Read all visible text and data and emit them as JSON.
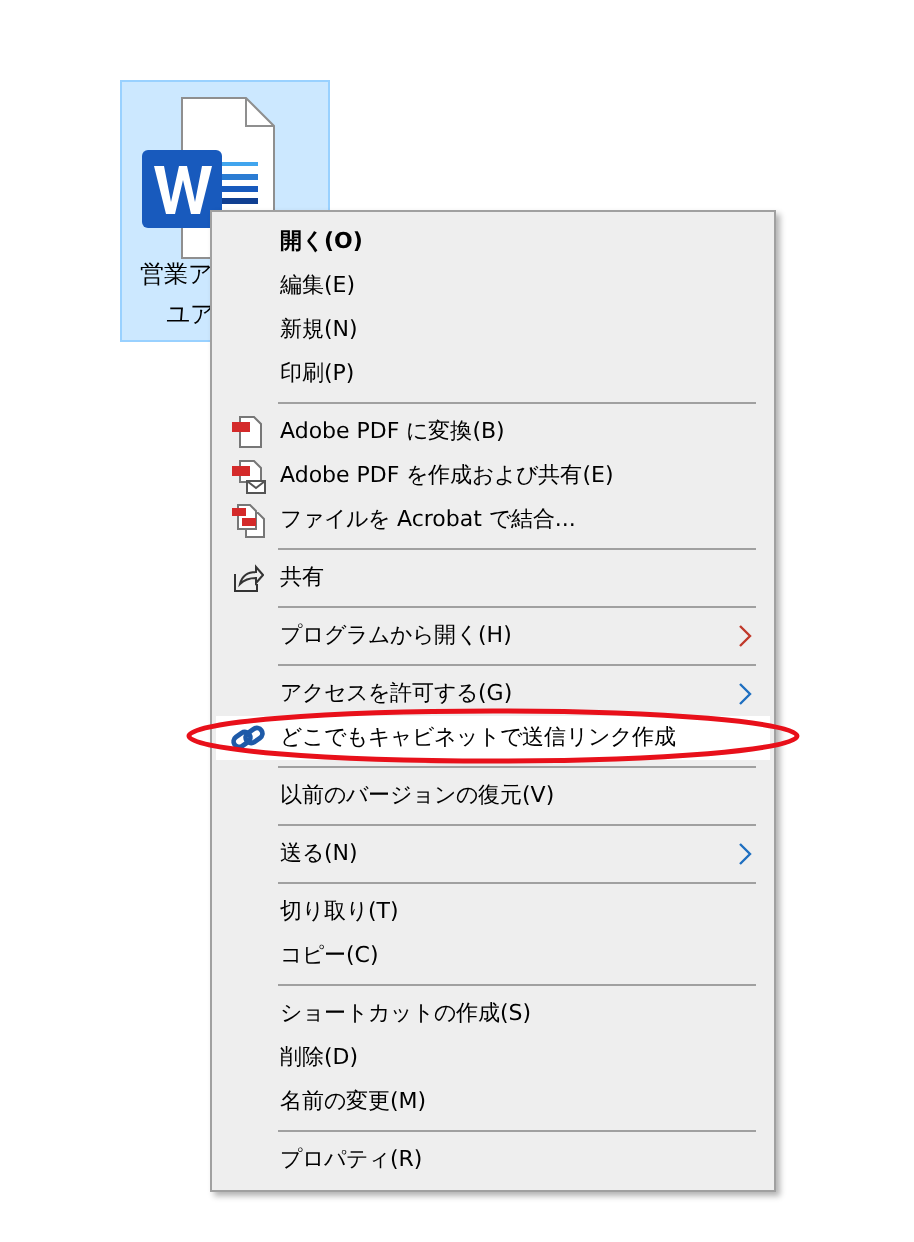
{
  "file": {
    "label_lines": [
      "営業ア",
      "ユア"
    ],
    "selected": true
  },
  "menu": {
    "items": [
      {
        "kind": "item",
        "label": "開く(O)",
        "bold": true,
        "submenu": false,
        "selected": false,
        "circled": false
      },
      {
        "kind": "item",
        "label": "編集(E)",
        "bold": false,
        "submenu": false,
        "selected": false,
        "circled": false
      },
      {
        "kind": "item",
        "label": "新規(N)",
        "bold": false,
        "submenu": false,
        "selected": false,
        "circled": false
      },
      {
        "kind": "item",
        "label": "印刷(P)",
        "bold": false,
        "submenu": false,
        "selected": false,
        "circled": false
      },
      {
        "kind": "separator"
      },
      {
        "kind": "item",
        "label": "Adobe PDF に変換(B)",
        "bold": false,
        "submenu": false,
        "selected": false,
        "circled": false
      },
      {
        "kind": "item",
        "label": "Adobe PDF を作成および共有(E)",
        "bold": false,
        "submenu": false,
        "selected": false,
        "circled": false
      },
      {
        "kind": "item",
        "label": "ファイルを Acrobat で結合...",
        "bold": false,
        "submenu": false,
        "selected": false,
        "circled": false
      },
      {
        "kind": "separator"
      },
      {
        "kind": "item",
        "label": "共有",
        "bold": false,
        "submenu": false,
        "selected": false,
        "circled": false
      },
      {
        "kind": "separator"
      },
      {
        "kind": "item",
        "label": "プログラムから開く(H)",
        "bold": false,
        "submenu": true,
        "selected": false,
        "circled": false
      },
      {
        "kind": "separator"
      },
      {
        "kind": "item",
        "label": "アクセスを許可する(G)",
        "bold": false,
        "submenu": true,
        "selected": false,
        "circled": false
      },
      {
        "kind": "item",
        "label": "どこでもキャビネットで送信リンク作成",
        "bold": false,
        "submenu": false,
        "selected": true,
        "circled": true
      },
      {
        "kind": "separator"
      },
      {
        "kind": "item",
        "label": "以前のバージョンの復元(V)",
        "bold": false,
        "submenu": false,
        "selected": false,
        "circled": false
      },
      {
        "kind": "separator"
      },
      {
        "kind": "item",
        "label": "送る(N)",
        "bold": false,
        "submenu": true,
        "selected": false,
        "circled": false
      },
      {
        "kind": "separator"
      },
      {
        "kind": "item",
        "label": "切り取り(T)",
        "bold": false,
        "submenu": false,
        "selected": false,
        "circled": false
      },
      {
        "kind": "item",
        "label": "コピー(C)",
        "bold": false,
        "submenu": false,
        "selected": false,
        "circled": false
      },
      {
        "kind": "separator"
      },
      {
        "kind": "item",
        "label": "ショートカットの作成(S)",
        "bold": false,
        "submenu": false,
        "selected": false,
        "circled": false
      },
      {
        "kind": "item",
        "label": "削除(D)",
        "bold": false,
        "submenu": false,
        "selected": false,
        "circled": false
      },
      {
        "kind": "item",
        "label": "名前の変更(M)",
        "bold": false,
        "submenu": false,
        "selected": false,
        "circled": false
      },
      {
        "kind": "separator"
      },
      {
        "kind": "item",
        "label": "プロパティ(R)",
        "bold": false,
        "submenu": false,
        "selected": false,
        "circled": false
      }
    ]
  }
}
